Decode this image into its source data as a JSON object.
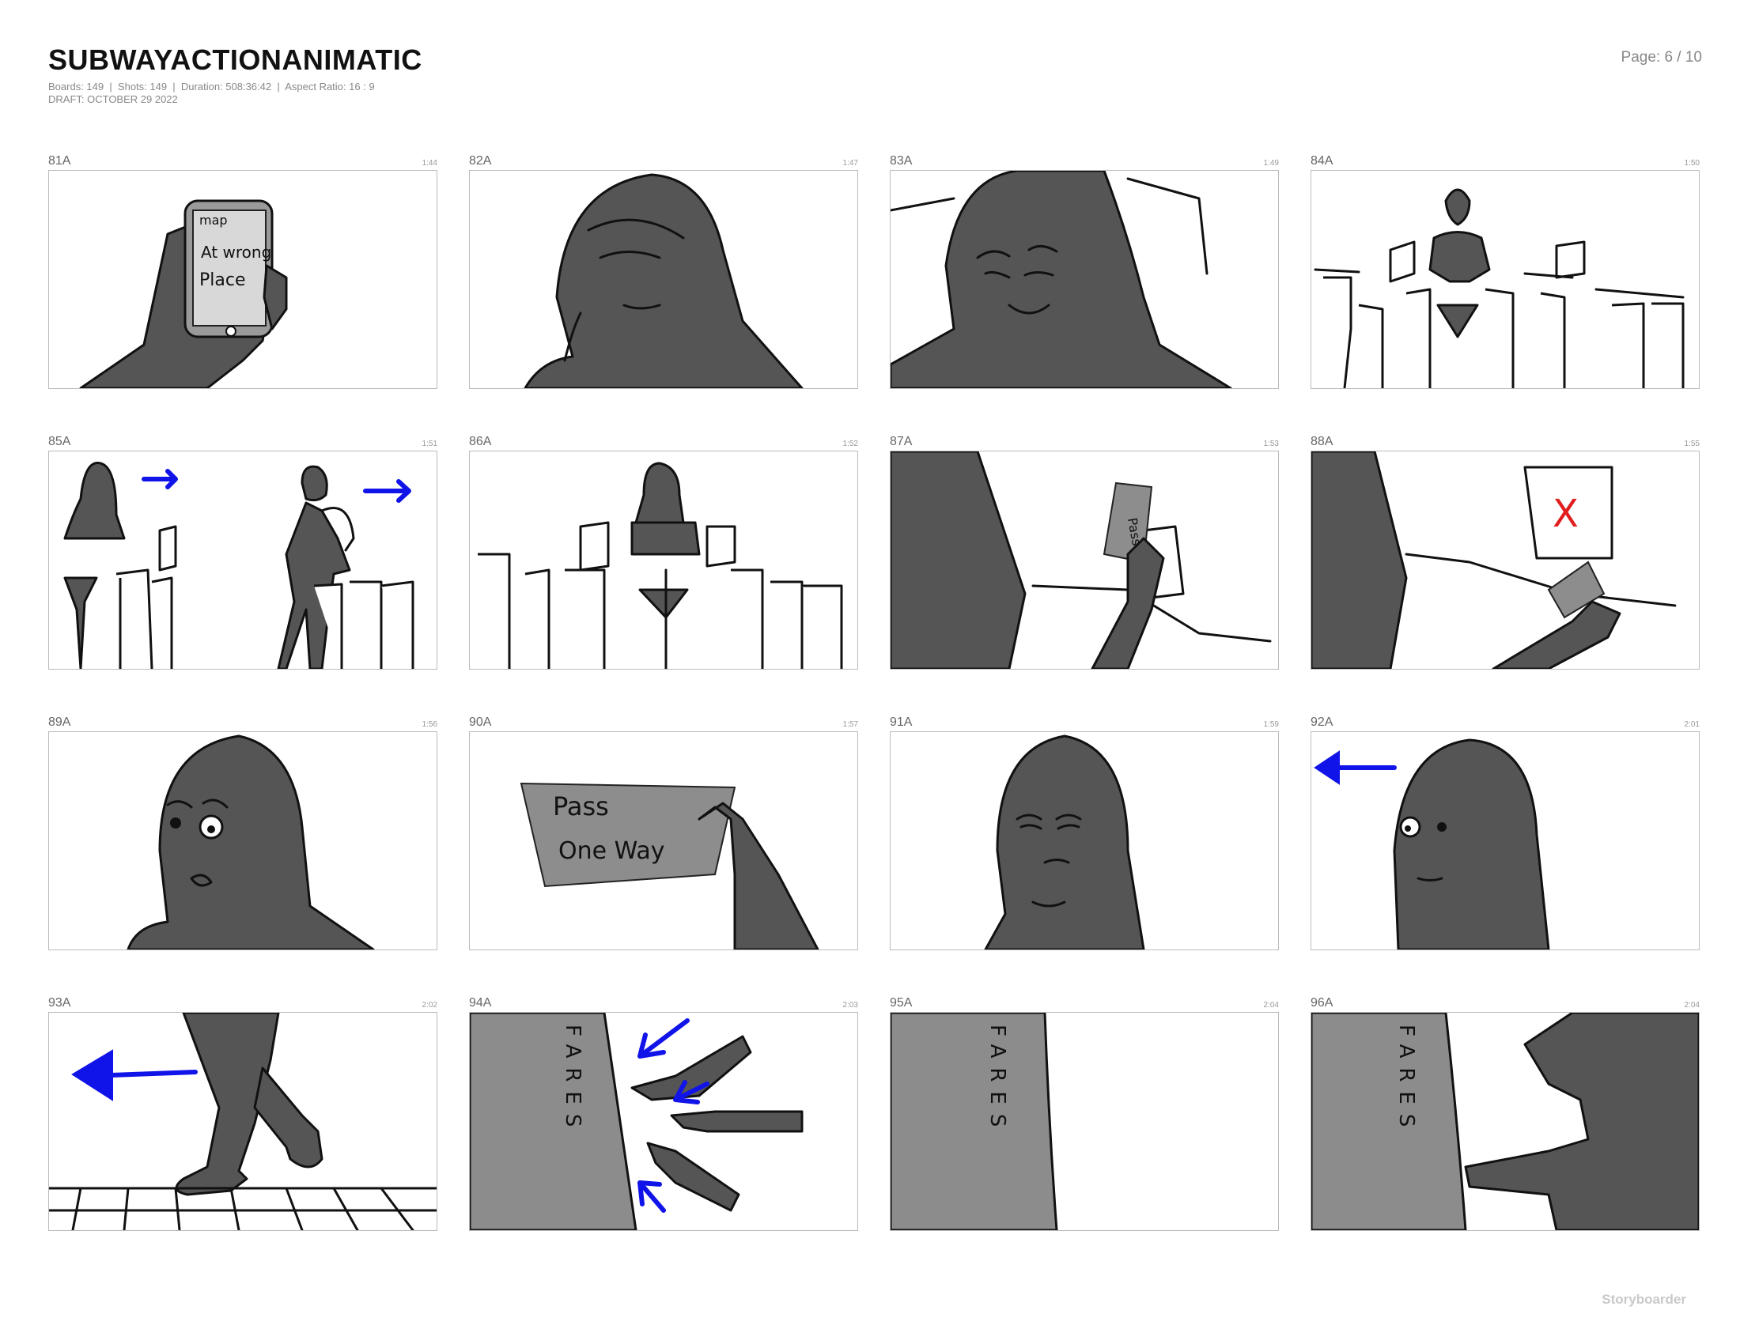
{
  "document": {
    "title": "SUBWAYACTIONANIMATIC",
    "stats": "Boards: 149  |  Shots: 149  |  Duration: 508:36:42  |  Aspect Ratio: 16 : 9",
    "draft": "DRAFT: OCTOBER 29 2022",
    "page": "Page: 6 / 10",
    "brand": "Storyboarder"
  },
  "boards": [
    {
      "id": "81A",
      "time": "1:44",
      "text": [
        "map",
        "At wrong",
        "Place"
      ]
    },
    {
      "id": "82A",
      "time": "1:47"
    },
    {
      "id": "83A",
      "time": "1:49"
    },
    {
      "id": "84A",
      "time": "1:50"
    },
    {
      "id": "85A",
      "time": "1:51"
    },
    {
      "id": "86A",
      "time": "1:52"
    },
    {
      "id": "87A",
      "time": "1:53",
      "text": [
        "Pass"
      ]
    },
    {
      "id": "88A",
      "time": "1:55",
      "text": [
        "X"
      ]
    },
    {
      "id": "89A",
      "time": "1:56"
    },
    {
      "id": "90A",
      "time": "1:57",
      "text": [
        "Pass",
        "One Way"
      ]
    },
    {
      "id": "91A",
      "time": "1:59"
    },
    {
      "id": "92A",
      "time": "2:01"
    },
    {
      "id": "93A",
      "time": "2:02"
    },
    {
      "id": "94A",
      "time": "2:03",
      "text": [
        "FARES"
      ]
    },
    {
      "id": "95A",
      "time": "2:04",
      "text": [
        "FARES"
      ]
    },
    {
      "id": "96A",
      "time": "2:04",
      "text": [
        "FARES"
      ]
    }
  ],
  "colors": {
    "arrow": "#1114e8",
    "denied": "#e21d1d",
    "ink": "#111111",
    "shadow": "#555555"
  }
}
